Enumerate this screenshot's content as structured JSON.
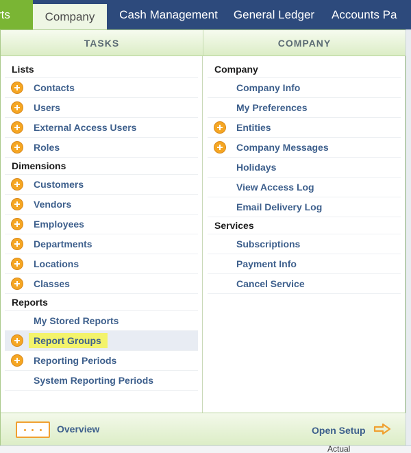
{
  "nav": {
    "tabs": [
      {
        "label": "rts"
      },
      {
        "label": "Company"
      },
      {
        "label": "Cash Management"
      },
      {
        "label": "General Ledger"
      },
      {
        "label": "Accounts Pa"
      }
    ]
  },
  "panel": {
    "tasks_header": "TASKS",
    "company_header": "COMPANY",
    "tasks": {
      "lists": {
        "title": "Lists",
        "items": [
          {
            "label": "Contacts"
          },
          {
            "label": "Users"
          },
          {
            "label": "External Access Users"
          },
          {
            "label": "Roles"
          }
        ]
      },
      "dimensions": {
        "title": "Dimensions",
        "items": [
          {
            "label": "Customers"
          },
          {
            "label": "Vendors"
          },
          {
            "label": "Employees"
          },
          {
            "label": "Departments"
          },
          {
            "label": "Locations"
          },
          {
            "label": "Classes"
          }
        ]
      },
      "reports": {
        "title": "Reports",
        "items": [
          {
            "label": "My Stored Reports"
          },
          {
            "label": "Report Groups"
          },
          {
            "label": "Reporting Periods"
          },
          {
            "label": "System Reporting Periods"
          }
        ]
      }
    },
    "company": {
      "company": {
        "title": "Company",
        "items": [
          {
            "label": "Company Info"
          },
          {
            "label": "My Preferences"
          },
          {
            "label": "Entities"
          },
          {
            "label": "Company Messages"
          },
          {
            "label": "Holidays"
          },
          {
            "label": "View Access Log"
          },
          {
            "label": "Email Delivery Log"
          }
        ]
      },
      "services": {
        "title": "Services",
        "items": [
          {
            "label": "Subscriptions"
          },
          {
            "label": "Payment Info"
          },
          {
            "label": "Cancel Service"
          }
        ]
      }
    }
  },
  "footer": {
    "overview_label": "Overview",
    "open_setup_label": "Open Setup"
  },
  "background": {
    "actual_text": "Actual"
  },
  "colors": {
    "nav_bg": "#2d4a7c",
    "accent_green": "#7ab534",
    "link_blue": "#3d5f8c",
    "plus_orange": "#f5a623",
    "highlight_yellow": "#f3f36b"
  }
}
